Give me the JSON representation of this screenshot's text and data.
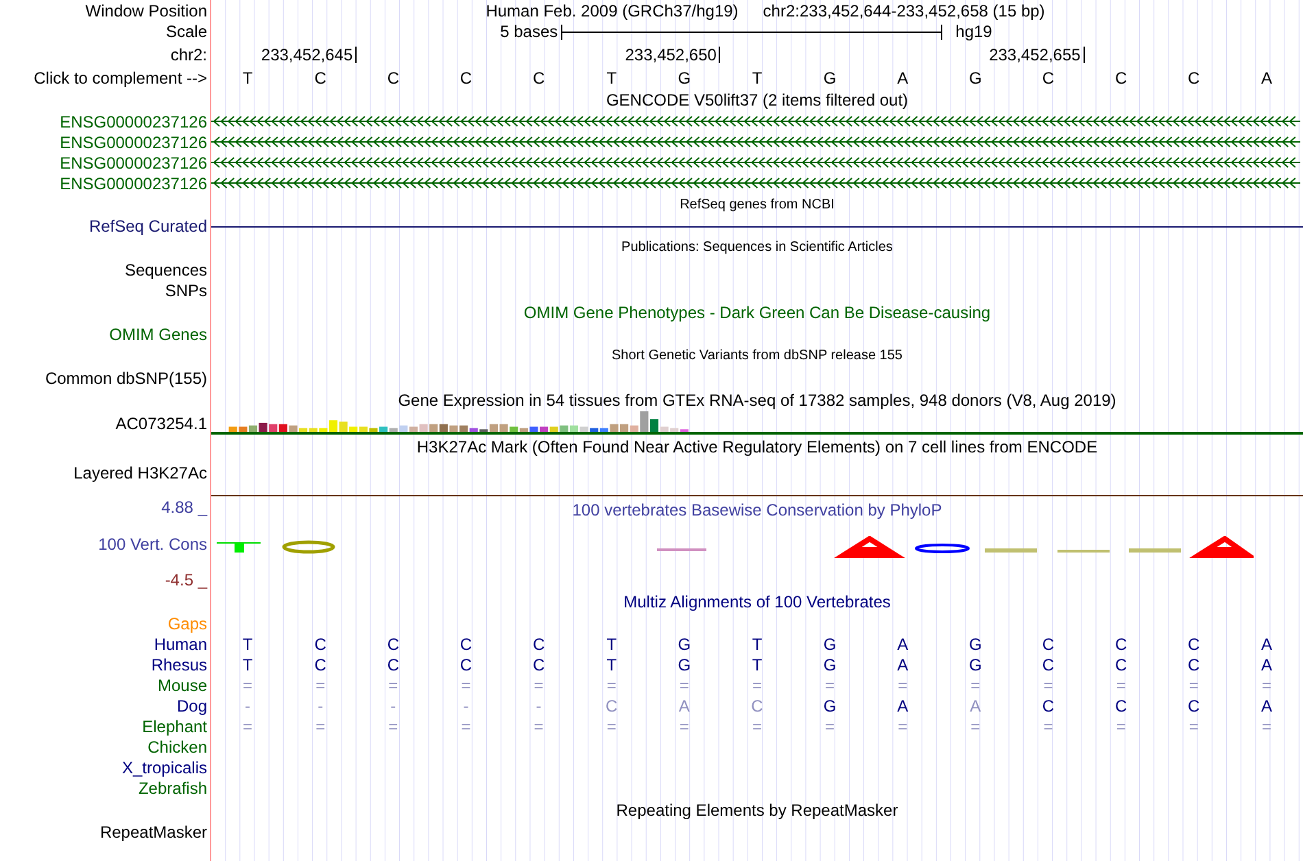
{
  "rows": [
    {
      "kind": "position",
      "label": "Window Position",
      "assembly": "Human Feb. 2009 (GRCh37/hg19)",
      "range": "chr2:233,452,644-233,452,658 (15 bp)"
    },
    {
      "kind": "scale",
      "label": "Scale",
      "span": "5 bases",
      "db": "hg19"
    },
    {
      "kind": "ruler",
      "label": "chr2:",
      "ticks": [
        "233,452,645",
        "233,452,650",
        "233,452,655"
      ]
    },
    {
      "kind": "bases",
      "label": "Click to complement -->",
      "bases": [
        "T",
        "C",
        "C",
        "C",
        "C",
        "T",
        "G",
        "T",
        "G",
        "A",
        "G",
        "C",
        "C",
        "C",
        "A"
      ]
    },
    {
      "kind": "title",
      "text": "GENCODE V50lift37 (2 items filtered out)"
    },
    {
      "kind": "gene",
      "label": "ENSG00000237126",
      "color": "#006400"
    },
    {
      "kind": "gene",
      "label": "ENSG00000237126",
      "color": "#006400"
    },
    {
      "kind": "gene",
      "label": "ENSG00000237126",
      "color": "#006400"
    },
    {
      "kind": "gene",
      "label": "ENSG00000237126",
      "color": "#006400"
    },
    {
      "kind": "caption",
      "text": "RefSeq genes from NCBI"
    },
    {
      "kind": "line",
      "label": "RefSeq Curated",
      "color": "#191970"
    },
    {
      "kind": "caption",
      "text": "Publications: Sequences in Scientific Articles"
    },
    {
      "kind": "label",
      "label": "Sequences"
    },
    {
      "kind": "label",
      "label": "SNPs"
    },
    {
      "kind": "title",
      "text": "OMIM Gene Phenotypes - Dark Green Can Be Disease-causing",
      "color": "#006400"
    },
    {
      "kind": "label",
      "label": "OMIM Genes",
      "color": "#006400"
    },
    {
      "kind": "caption",
      "text": "Short Genetic Variants from dbSNP release 155"
    },
    {
      "kind": "label",
      "label": "Common dbSNP(155)"
    },
    {
      "kind": "title",
      "text": "Gene Expression in 54 tissues from GTEx RNA-seq of 17382 samples, 948 donors (V8, Aug 2019)"
    },
    {
      "kind": "bars",
      "label": "AC073254.1",
      "color": "#006400"
    },
    {
      "kind": "title",
      "text": "H3K27Ac Mark (Often Found Near Active Regulatory Elements) on 7 cell lines from ENCODE"
    },
    {
      "kind": "layered",
      "label": "Layered H3K27Ac",
      "color": "#663300"
    },
    {
      "kind": "wiggle",
      "label": "100 Vert. Cons",
      "max": "4.88 _",
      "min": "-4.5 _",
      "title": "100 vertebrates Basewise Conservation by PhyloP",
      "color": "#4040a0"
    },
    {
      "kind": "title",
      "text": "Multiz Alignments of 100 Vertebrates",
      "color": "#000080"
    },
    {
      "kind": "label",
      "label": "Gaps",
      "color": "#ff8c00"
    },
    {
      "kind": "alignment",
      "label": "Human",
      "color": "#000080",
      "bases": [
        {
          "text": "T",
          "faded": false
        },
        {
          "text": "C",
          "faded": false
        },
        {
          "text": "C",
          "faded": false
        },
        {
          "text": "C",
          "faded": false
        },
        {
          "text": "C",
          "faded": false
        },
        {
          "text": "T",
          "faded": false
        },
        {
          "text": "G",
          "faded": false
        },
        {
          "text": "T",
          "faded": false
        },
        {
          "text": "G",
          "faded": false
        },
        {
          "text": "A",
          "faded": false
        },
        {
          "text": "G",
          "faded": false
        },
        {
          "text": "C",
          "faded": false
        },
        {
          "text": "C",
          "faded": false
        },
        {
          "text": "C",
          "faded": false
        },
        {
          "text": "A",
          "faded": false
        }
      ]
    },
    {
      "kind": "alignment",
      "label": "Rhesus",
      "color": "#000080",
      "bases": [
        {
          "text": "T",
          "faded": false
        },
        {
          "text": "C",
          "faded": false
        },
        {
          "text": "C",
          "faded": false
        },
        {
          "text": "C",
          "faded": false
        },
        {
          "text": "C",
          "faded": false
        },
        {
          "text": "T",
          "faded": false
        },
        {
          "text": "G",
          "faded": false
        },
        {
          "text": "T",
          "faded": false
        },
        {
          "text": "G",
          "faded": false
        },
        {
          "text": "A",
          "faded": false
        },
        {
          "text": "G",
          "faded": false
        },
        {
          "text": "C",
          "faded": false
        },
        {
          "text": "C",
          "faded": false
        },
        {
          "text": "C",
          "faded": false
        },
        {
          "text": "A",
          "faded": false
        }
      ]
    },
    {
      "kind": "alignment",
      "label": "Mouse",
      "color": "#006400",
      "bases": [
        {
          "text": "=",
          "faded": true
        },
        {
          "text": "=",
          "faded": true
        },
        {
          "text": "=",
          "faded": true
        },
        {
          "text": "=",
          "faded": true
        },
        {
          "text": "=",
          "faded": true
        },
        {
          "text": "=",
          "faded": true
        },
        {
          "text": "=",
          "faded": true
        },
        {
          "text": "=",
          "faded": true
        },
        {
          "text": "=",
          "faded": true
        },
        {
          "text": "=",
          "faded": true
        },
        {
          "text": "=",
          "faded": true
        },
        {
          "text": "=",
          "faded": true
        },
        {
          "text": "=",
          "faded": true
        },
        {
          "text": "=",
          "faded": true
        },
        {
          "text": "=",
          "faded": true
        }
      ]
    },
    {
      "kind": "alignment",
      "label": "Dog",
      "color": "#000080",
      "bases": [
        {
          "text": "-",
          "faded": true
        },
        {
          "text": "-",
          "faded": true
        },
        {
          "text": "-",
          "faded": true
        },
        {
          "text": "-",
          "faded": true
        },
        {
          "text": "-",
          "faded": true
        },
        {
          "text": "C",
          "faded": true
        },
        {
          "text": "A",
          "faded": true
        },
        {
          "text": "C",
          "faded": true
        },
        {
          "text": "G",
          "faded": false
        },
        {
          "text": "A",
          "faded": false
        },
        {
          "text": "A",
          "faded": true
        },
        {
          "text": "C",
          "faded": false
        },
        {
          "text": "C",
          "faded": false
        },
        {
          "text": "C",
          "faded": false
        },
        {
          "text": "A",
          "faded": false
        }
      ]
    },
    {
      "kind": "alignment",
      "label": "Elephant",
      "color": "#006400",
      "bases": [
        {
          "text": "=",
          "faded": true
        },
        {
          "text": "=",
          "faded": true
        },
        {
          "text": "=",
          "faded": true
        },
        {
          "text": "=",
          "faded": true
        },
        {
          "text": "=",
          "faded": true
        },
        {
          "text": "=",
          "faded": true
        },
        {
          "text": "=",
          "faded": true
        },
        {
          "text": "=",
          "faded": true
        },
        {
          "text": "=",
          "faded": true
        },
        {
          "text": "=",
          "faded": true
        },
        {
          "text": "=",
          "faded": true
        },
        {
          "text": "=",
          "faded": true
        },
        {
          "text": "=",
          "faded": true
        },
        {
          "text": "=",
          "faded": true
        },
        {
          "text": "=",
          "faded": true
        }
      ]
    },
    {
      "kind": "label",
      "label": "Chicken",
      "color": "#006400"
    },
    {
      "kind": "label",
      "label": "X_tropicalis",
      "color": "#000080"
    },
    {
      "kind": "label",
      "label": "Zebrafish",
      "color": "#006400"
    },
    {
      "kind": "title",
      "text": "Repeating Elements by RepeatMasker"
    },
    {
      "kind": "label",
      "label": "RepeatMasker"
    }
  ]
}
